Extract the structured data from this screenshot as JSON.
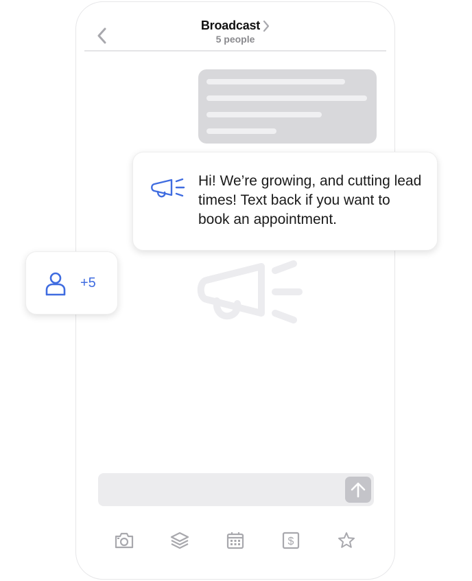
{
  "header": {
    "title": "Broadcast",
    "subtitle": "5 people",
    "back_icon": "chevron-left-icon",
    "title_chevron_icon": "chevron-right-icon"
  },
  "message_card": {
    "icon": "megaphone-icon",
    "text": "Hi! We’re growing, and cutting lead times! Text back if you want to book an appointment."
  },
  "people_card": {
    "icon": "person-icon",
    "count": "+5"
  },
  "composer": {
    "send_icon": "arrow-up-icon"
  },
  "toolbar": {
    "items": [
      "camera-icon",
      "layers-icon",
      "calendar-icon",
      "dollar-icon",
      "star-icon"
    ]
  },
  "colors": {
    "accent": "#3f6ce0",
    "icon_gray": "#a8a8ad",
    "placeholder_bubble": "#d8d8db",
    "composer_bg": "#ececee"
  }
}
